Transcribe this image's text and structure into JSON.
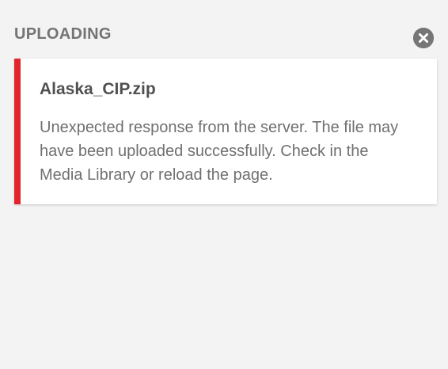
{
  "upload_panel": {
    "title": "UPLOADING",
    "close_icon": "close-circle-icon",
    "items": [
      {
        "file_name": "Alaska_CIP.zip",
        "status": "error",
        "message": "Unexpected response from the server. The file may have been uploaded successfully. Check in the Media Library or reload the page."
      }
    ]
  },
  "colors": {
    "background": "#f3f3f3",
    "error_accent": "#e3242b",
    "title_text": "#747474",
    "close_icon": "#767676",
    "card_background": "#ffffff"
  }
}
